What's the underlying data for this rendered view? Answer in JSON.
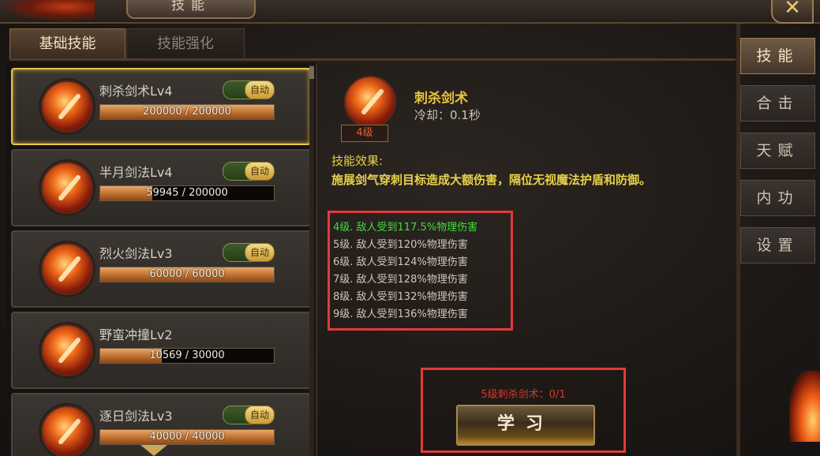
{
  "window": {
    "title": "技能",
    "close_label": "✕"
  },
  "tabs": [
    {
      "label": "基础技能",
      "active": true
    },
    {
      "label": "技能强化",
      "active": false
    }
  ],
  "skills": [
    {
      "name": "刺杀剑术Lv4",
      "auto": "自动",
      "progress": "200000 / 200000",
      "current": 200000,
      "max": 200000,
      "selected": true
    },
    {
      "name": "半月剑法Lv4",
      "auto": "自动",
      "progress": "59945 / 200000",
      "current": 59945,
      "max": 200000,
      "selected": false
    },
    {
      "name": "烈火剑法Lv3",
      "auto": "自动",
      "progress": "60000 / 60000",
      "current": 60000,
      "max": 60000,
      "selected": false
    },
    {
      "name": "野蛮冲撞Lv2",
      "auto": "",
      "progress": "10569 / 30000",
      "current": 10569,
      "max": 30000,
      "selected": false
    },
    {
      "name": "逐日剑法Lv3",
      "auto": "自动",
      "progress": "40000 / 40000",
      "current": 40000,
      "max": 40000,
      "selected": false
    }
  ],
  "detail": {
    "level_badge": "4级",
    "name": "刺杀剑术",
    "cooldown": "冷却：0.1秒",
    "effect_heading": "技能效果:",
    "effect_text": "施展剑气穿刺目标造成大额伤害，隔位无视魔法护盾和防御。",
    "levels": [
      {
        "text": "4级.  敌人受到117.5%物理伤害",
        "current": true
      },
      {
        "text": "5级.  敌人受到120%物理伤害",
        "current": false
      },
      {
        "text": "6级.  敌人受到124%物理伤害",
        "current": false
      },
      {
        "text": "7级.  敌人受到128%物理伤害",
        "current": false
      },
      {
        "text": "8级.  敌人受到132%物理伤害",
        "current": false
      },
      {
        "text": "9级.  敌人受到136%物理伤害",
        "current": false
      }
    ],
    "requirement": "5级刺杀剑术：0/1",
    "learn_label": "学习"
  },
  "right_menu": [
    {
      "label": "技能",
      "active": true
    },
    {
      "label": "合击",
      "active": false
    },
    {
      "label": "天赋",
      "active": false
    },
    {
      "label": "内功",
      "active": false
    },
    {
      "label": "设置",
      "active": false
    }
  ],
  "colors": {
    "selected_border": "#e8c44a",
    "highlight_box": "#e23a3a",
    "current_level": "#3ce03a",
    "effect_text": "#e8d24a"
  }
}
